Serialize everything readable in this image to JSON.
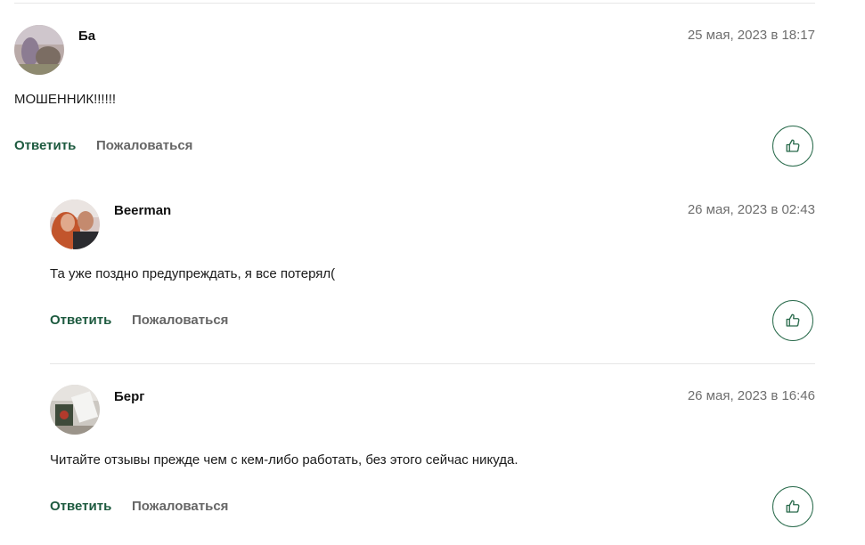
{
  "comments": [
    {
      "author": "Ба",
      "date": "25 мая, 2023 в 18:17",
      "text": "МОШЕННИК!!!!!!",
      "reply_label": "Ответить",
      "complain_label": "Пожаловаться",
      "like_icon": "thumbs-up-icon"
    },
    {
      "author": "Beerman",
      "date": "26 мая, 2023 в 02:43",
      "text": "Та уже поздно предупреждать, я все потерял(",
      "reply_label": "Ответить",
      "complain_label": "Пожаловаться",
      "like_icon": "thumbs-up-icon"
    },
    {
      "author": "Берг",
      "date": "26 мая, 2023 в 16:46",
      "text": "Читайте отзывы прежде чем с кем-либо работать, без этого сейчас никуда.",
      "reply_label": "Ответить",
      "complain_label": "Пожаловаться",
      "like_icon": "thumbs-up-icon"
    }
  ],
  "colors": {
    "accent": "#1d5a3f",
    "like_border": "#2a6b4c",
    "muted": "#6e6e6e",
    "divider": "#e6e6e6"
  }
}
